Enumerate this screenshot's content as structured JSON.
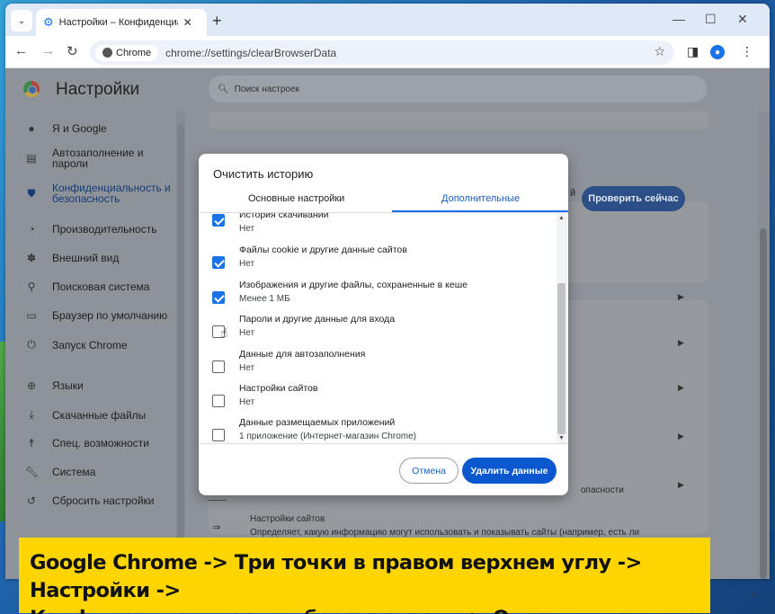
{
  "browser": {
    "tab_title": "Настройки – Конфиденциальн",
    "tab_close": "✕",
    "new_tab": "+",
    "window_controls": [
      "—",
      "☐",
      "✕"
    ],
    "chip_label": "Chrome",
    "url": "chrome://settings/clearBrowserData"
  },
  "settings": {
    "title": "Настройки",
    "search_placeholder": "Поиск настроек",
    "sidebar": [
      {
        "icon": "person-icon",
        "label": "Я и Google"
      },
      {
        "icon": "clipboard-icon",
        "label": "Автозаполнение и\nпароли"
      },
      {
        "icon": "shield-icon",
        "label": "Конфиденциальность и\nбезопасность",
        "active": true
      },
      {
        "icon": "speedometer-icon",
        "label": "Производительность"
      },
      {
        "icon": "palette-icon",
        "label": "Внешний вид"
      },
      {
        "icon": "search-icon",
        "label": "Поисковая система"
      },
      {
        "icon": "browser-icon",
        "label": "Браузер по умолчанию"
      },
      {
        "icon": "power-icon",
        "label": "Запуск Chrome"
      },
      {
        "icon": "globe-icon",
        "label": "Языки"
      },
      {
        "icon": "download-icon",
        "label": "Скачанные файлы"
      },
      {
        "icon": "accessibility-icon",
        "label": "Спец. возможности"
      },
      {
        "icon": "wrench-icon",
        "label": "Система"
      },
      {
        "icon": "reset-icon",
        "label": "Сбросить настройки"
      }
    ],
    "check_now_button": "Проверить сейчас",
    "background_snippets": {
      "partial_word": "й",
      "security_tail": "опасности",
      "site_settings_title": "Настройки сайтов",
      "site_settings_desc": "Определяет, какую информацию могут использовать и показывать сайты (например, есть ли"
    }
  },
  "dialog": {
    "title": "Очистить историю",
    "tabs": [
      {
        "label": "Основные настройки",
        "active": false
      },
      {
        "label": "Дополнительные",
        "active": true
      }
    ],
    "items": [
      {
        "label": "История скачиваний",
        "sub": "Нет",
        "checked": true
      },
      {
        "label": "Файлы cookie и другие данные сайтов",
        "sub": "Нет",
        "checked": true
      },
      {
        "label": "Изображения и другие файлы, сохраненные в кеше",
        "sub": "Менее 1 МБ",
        "checked": true
      },
      {
        "label": "Пароли и другие данные для входа",
        "sub": "Нет",
        "checked": false
      },
      {
        "label": "Данные для автозаполнения",
        "sub": "Нет",
        "checked": false
      },
      {
        "label": "Настройки сайтов",
        "sub": "Нет",
        "checked": false
      },
      {
        "label": "Данные размещаемых приложений",
        "sub": "1 приложение (Интернет-магазин Chrome)",
        "checked": false
      }
    ],
    "cancel_label": "Отмена",
    "delete_label": "Удалить данные"
  },
  "caption": {
    "line1": "Google Chrome -> Три точки в правом верхнем углу -> Настройки ->",
    "line2": "Конфиденциальность и безопасность -> Очистить историю"
  },
  "colors": {
    "accent": "#1a73e8",
    "delete_button": "#0b57d0",
    "banner": "#ffd500"
  }
}
